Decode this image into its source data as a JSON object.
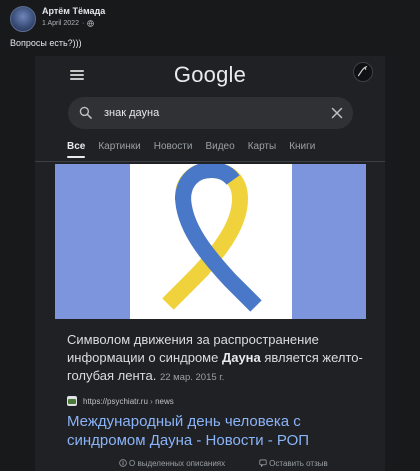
{
  "post": {
    "author": "Артём Тёмада",
    "date": "1 April 2022",
    "date_separator": "·",
    "text": "Вопросы есть?)))"
  },
  "google": {
    "logo": "Google",
    "search_query": "знак дауна",
    "tabs": [
      "Все",
      "Картинки",
      "Новости",
      "Видео",
      "Карты",
      "Книги"
    ],
    "active_tab_index": 0,
    "image_colors": {
      "band": "#7d95dd",
      "ribbon_blue": "#4a78c8",
      "ribbon_yellow": "#f0d33c"
    },
    "snippet": {
      "text_before": "Символом движения за распространение информации о синдроме ",
      "bold": "Дауна",
      "text_after": " является желто-голубая лента.",
      "date": "22 мар. 2015 г."
    },
    "source": {
      "url": "https://psychiatr.ru",
      "separator": "›",
      "path": "news"
    },
    "result_title": "Международный день человека с синдромом Дауна - Новости - РОП",
    "footer": {
      "about": "О выделенных описаниях",
      "feedback": "Оставить отзыв"
    }
  }
}
